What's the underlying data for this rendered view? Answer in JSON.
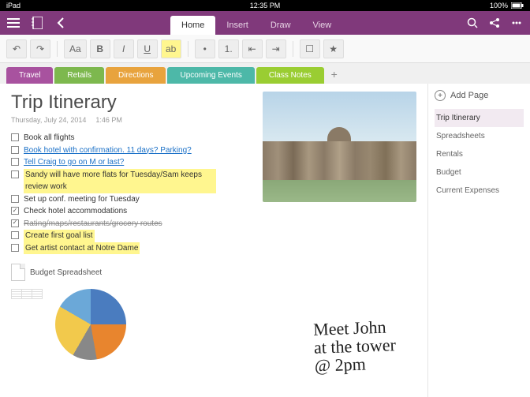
{
  "statusbar": {
    "carrier": "iPad",
    "time": "12:35 PM",
    "battery": "100%"
  },
  "appbar": {
    "tabs": [
      "Home",
      "Insert",
      "Draw",
      "View"
    ],
    "active_tab": 0
  },
  "sections": {
    "items": [
      {
        "label": "Travel",
        "color": "purple"
      },
      {
        "label": "Retails",
        "color": "green"
      },
      {
        "label": "Directions",
        "color": "orange"
      },
      {
        "label": "Upcoming Events",
        "color": "teal"
      },
      {
        "label": "Class Notes",
        "color": "lime"
      }
    ]
  },
  "page": {
    "title": "Trip Itinerary",
    "date": "Thursday, July 24, 2014",
    "time": "1:46 PM"
  },
  "checklist": [
    {
      "checked": false,
      "text": "Book all flights",
      "style": "plain"
    },
    {
      "checked": false,
      "text": "Book hotel with confirmation. 11 days? Parking?",
      "style": "link"
    },
    {
      "checked": false,
      "text": "Tell Craig to go on M or last?",
      "style": "link"
    },
    {
      "checked": false,
      "text": "Sandy will have more flats for Tuesday/Sam keeps review work",
      "style": "hl"
    },
    {
      "checked": false,
      "text": "Set up conf. meeting for Tuesday",
      "style": "plain"
    },
    {
      "checked": true,
      "text": "Check hotel accommodations",
      "style": "plain"
    },
    {
      "checked": true,
      "text": "Rating/maps/restaurants/grocery routes",
      "style": "strike"
    },
    {
      "checked": false,
      "text": "Create first goal list",
      "style": "hl"
    },
    {
      "checked": false,
      "text": "Get artist contact at Notre Dame",
      "style": "hl"
    }
  ],
  "attachment": {
    "label": "Budget Spreadsheet"
  },
  "chart_data": {
    "type": "pie",
    "title": "",
    "series": [
      {
        "name": "Blue",
        "value": 25,
        "color": "#4a7cbf"
      },
      {
        "name": "Orange",
        "value": 22,
        "color": "#e8852e"
      },
      {
        "name": "Gray",
        "value": 11,
        "color": "#888888"
      },
      {
        "name": "Yellow",
        "value": 25,
        "color": "#f2c94c"
      },
      {
        "name": "LightBlue",
        "value": 17,
        "color": "#6ba8d8"
      }
    ]
  },
  "table": {
    "rows": [
      [
        "",
        "",
        ""
      ],
      [
        "",
        "",
        ""
      ],
      [
        "",
        "",
        ""
      ],
      [
        "",
        "",
        ""
      ]
    ]
  },
  "handwriting": "Meet John\nat the tower\n@ 2pm",
  "pagepane": {
    "add_label": "Add Page",
    "pages": [
      "Trip Itinerary",
      "Spreadsheets",
      "Rentals",
      "Budget",
      "Current Expenses"
    ],
    "active": 0
  },
  "colors": {
    "brand": "#80397b"
  }
}
